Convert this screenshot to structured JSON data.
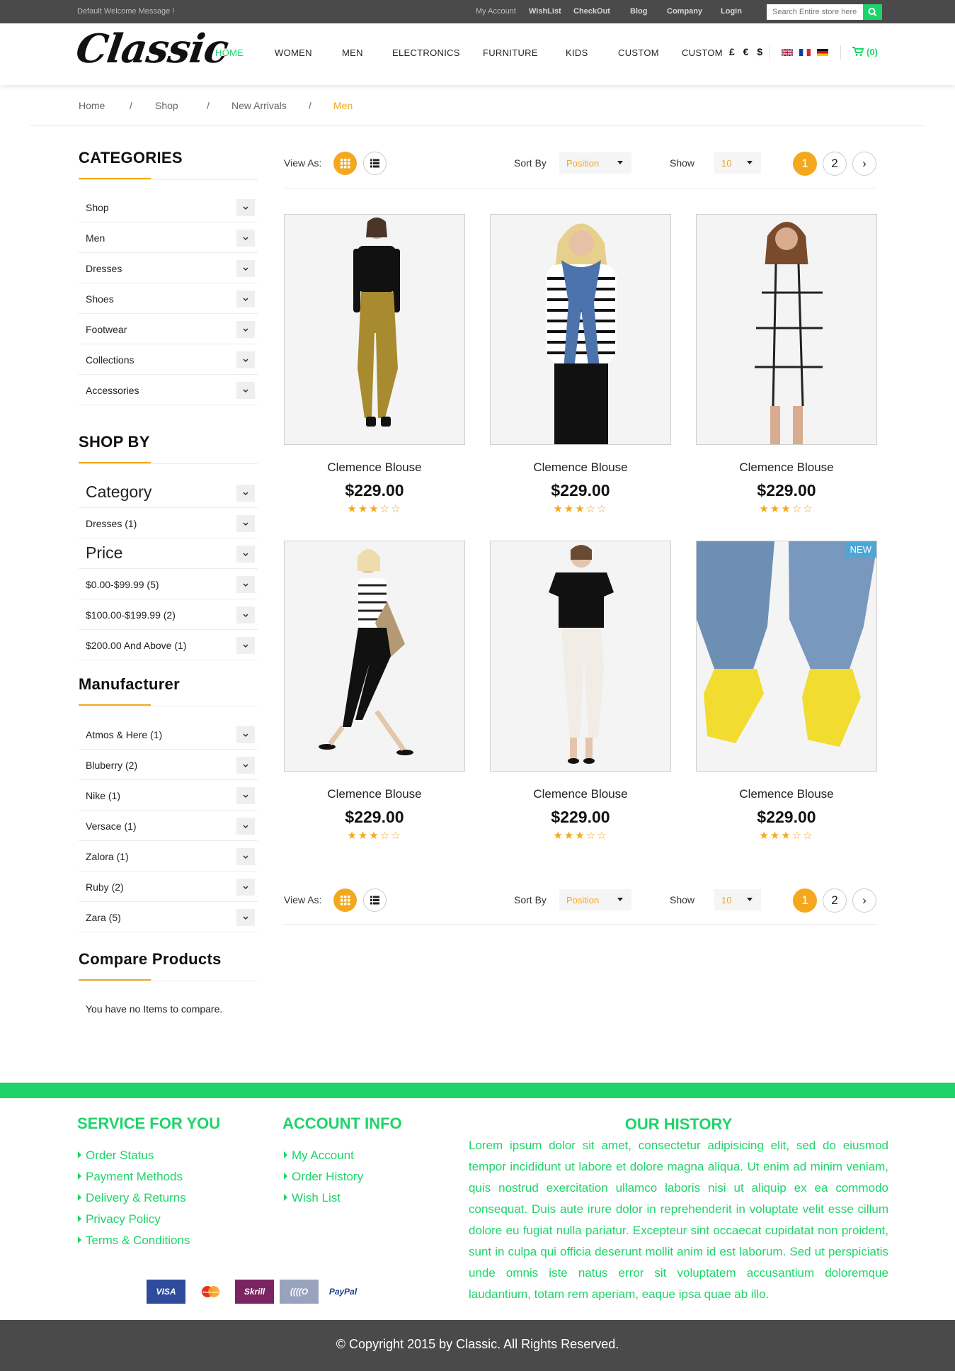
{
  "topbar": {
    "welcome": "Default Welcome Message !",
    "links": [
      "My Account",
      "WishList",
      "CheckOut",
      "Blog",
      "Company",
      "Login"
    ],
    "search_placeholder": "Search Entire store here"
  },
  "header": {
    "logo": "Classic",
    "nav": [
      "HOME",
      "WOMEN",
      "MEN",
      "ELECTRONICS",
      "FURNITURE",
      "KIDS",
      "CUSTOM",
      "CUSTOM"
    ],
    "currency": "£ € $",
    "cart": "(0)",
    "accent_color": "#1ed46a"
  },
  "breadcrumb": [
    "Home",
    "Shop",
    "New Arrivals",
    "Men"
  ],
  "sidebar": {
    "categories_title": "CATEGORIES",
    "categories": [
      "Shop",
      "Men",
      "Dresses",
      "Shoes",
      "Footwear",
      "Collections",
      "Accessories"
    ],
    "shopby_title": "SHOP BY",
    "shopby_category_heading": "Category",
    "shopby_category_items": [
      "Dresses (1)"
    ],
    "shopby_price_heading": "Price",
    "shopby_price_items": [
      "$0.00-$99.99 (5)",
      "$100.00-$199.99 (2)",
      "$200.00 And Above (1)"
    ],
    "manufacturer_title": "Manufacturer",
    "manufacturers": [
      "Atmos & Here (1)",
      "Bluberry (2)",
      "Nike (1)",
      "Versace (1)",
      "Zalora (1)",
      "Ruby (2)",
      "Zara (5)"
    ],
    "compare_title": "Compare Products",
    "compare_text": "You have no Items to compare."
  },
  "toolbar": {
    "view_as": "View As:",
    "sort_by": "Sort By",
    "sort_value": "Position",
    "show": "Show",
    "show_value": "10",
    "pages": [
      "1",
      "2"
    ],
    "next": "›"
  },
  "products": [
    {
      "name": "Clemence Blouse",
      "price": "$229.00",
      "rating": 3,
      "stars": "★★★☆☆",
      "badge": ""
    },
    {
      "name": "Clemence Blouse",
      "price": "$229.00",
      "rating": 3,
      "stars": "★★★☆☆",
      "badge": ""
    },
    {
      "name": "Clemence Blouse",
      "price": "$229.00",
      "rating": 3,
      "stars": "★★★☆☆",
      "badge": ""
    },
    {
      "name": "Clemence Blouse",
      "price": "$229.00",
      "rating": 3,
      "stars": "★★★☆☆",
      "badge": ""
    },
    {
      "name": "Clemence Blouse",
      "price": "$229.00",
      "rating": 3,
      "stars": "★★★☆☆",
      "badge": ""
    },
    {
      "name": "Clemence Blouse",
      "price": "$229.00",
      "rating": 3,
      "stars": "★★★☆☆",
      "badge": "NEW"
    }
  ],
  "footer": {
    "service_title": "SERVICE FOR YOU",
    "service_links": [
      "Order Status",
      "Payment Methods",
      "Delivery & Returns",
      "Privacy Policy",
      "Terms & Conditions"
    ],
    "account_title": "ACCOUNT INFO",
    "account_links": [
      "My Account",
      "Order History",
      "Wish List"
    ],
    "history_title": "OUR HISTORY",
    "history_text": "Lorem ipsum dolor sit amet, consectetur adipisicing elit, sed do eiusmod tempor incididunt ut labore et dolore magna aliqua. Ut enim ad minim veniam, quis nostrud exercitation ullamco laboris nisi ut aliquip ex ea commodo consequat. Duis aute irure dolor in reprehenderit in voluptate velit esse cillum dolore eu fugiat nulla pariatur. Excepteur sint occaecat cupidatat non proident, sunt in culpa qui officia deserunt mollit anim id est laborum. Sed ut perspiciatis unde omnis iste natus error sit voluptatem accusantium doloremque laudantium, totam rem aperiam, eaque ipsa quae ab illo.",
    "payments": [
      "VISA",
      "MasterCard",
      "Skrill",
      "((((O",
      "PayPal"
    ],
    "copyright": "© Copyright 2015 by Classic. All Rights Reserved."
  }
}
